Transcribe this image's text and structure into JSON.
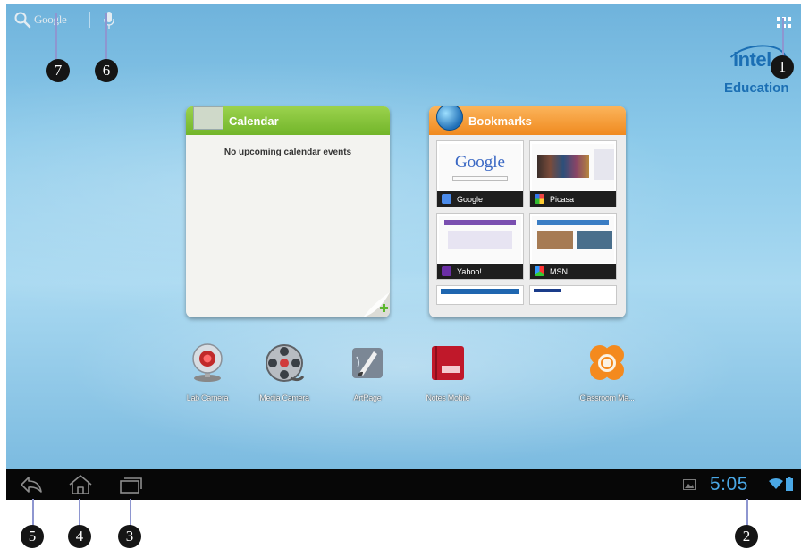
{
  "search": {
    "label": "Google",
    "icon": "search-icon"
  },
  "voice": {
    "icon": "microphone-icon"
  },
  "apps_button": {
    "icon": "all-apps-grid-icon"
  },
  "branding": {
    "logo_word": "intel",
    "subtitle": "Education"
  },
  "calendar_widget": {
    "title": "Calendar",
    "message": "No upcoming calendar events",
    "add_icon": "plus-icon"
  },
  "bookmarks_widget": {
    "title": "Bookmarks",
    "items": [
      {
        "label": "Google",
        "page_logo": "Google",
        "icon": "google-favicon"
      },
      {
        "label": "Picasa",
        "icon": "picasa-favicon"
      },
      {
        "label": "Yahoo!",
        "icon": "yahoo-favicon"
      },
      {
        "label": "MSN",
        "icon": "msn-favicon"
      }
    ]
  },
  "apps": [
    {
      "label": "Lab Camera",
      "icon": "webcam-icon"
    },
    {
      "label": "Media Camera",
      "icon": "film-reel-icon"
    },
    {
      "label": "ArtRage",
      "icon": "paint-brush-icon"
    },
    {
      "label": "Notes Mobile",
      "icon": "red-notebook-icon"
    },
    {
      "label": "Classroom Ma...",
      "icon": "classroom-flower-icon"
    }
  ],
  "system_bar": {
    "time": "5:05",
    "buttons": [
      "back-icon",
      "home-icon",
      "recent-apps-icon"
    ],
    "status_icons": [
      "gallery-notification-icon",
      "wifi-icon",
      "battery-icon"
    ]
  },
  "callouts": [
    "7",
    "6",
    "1",
    "5",
    "4",
    "3",
    "2"
  ],
  "colors": {
    "calendar_header": "#72b52a",
    "bookmarks_header": "#f08a1f",
    "clock": "#4aa8e6",
    "intel_blue": "#1b6fb4",
    "callout_line": "#8e96d0"
  }
}
